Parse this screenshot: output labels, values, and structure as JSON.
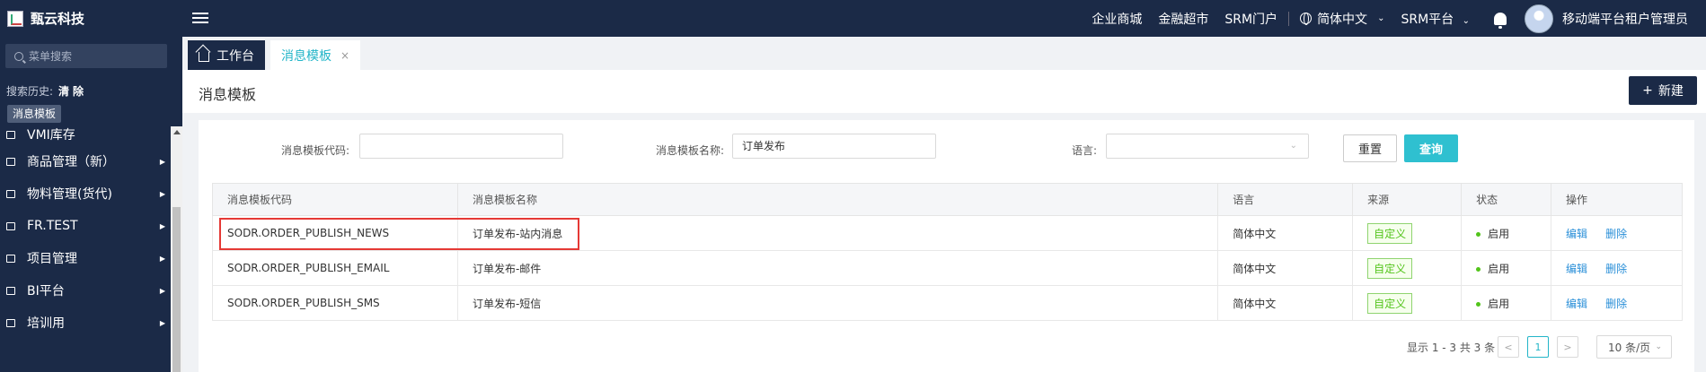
{
  "header": {
    "logo_text": "甄云科技",
    "nav_links": [
      "企业商城",
      "金融超市",
      "SRM门户"
    ],
    "language": "简体中文",
    "platform": "SRM平台",
    "user_name": "移动端平台租户管理员"
  },
  "sidebar": {
    "search_placeholder": "菜单搜索",
    "history_label": "搜索历史:",
    "clear_label": "清除",
    "history_tag": "消息模板",
    "items": [
      {
        "label": "VMI库存"
      },
      {
        "label": "商品管理（新）"
      },
      {
        "label": "物料管理(货代)"
      },
      {
        "label": "FR.TEST"
      },
      {
        "label": "项目管理"
      },
      {
        "label": "BI平台"
      },
      {
        "label": "培训用"
      }
    ]
  },
  "tabs": {
    "home": "工作台",
    "active": "消息模板",
    "close": "×"
  },
  "page": {
    "title": "消息模板",
    "new_button": "新建"
  },
  "filters": {
    "code_label": "消息模板代码:",
    "code_value": "",
    "name_label": "消息模板名称:",
    "name_value": "订单发布",
    "lang_label": "语言:",
    "lang_value": "",
    "reset": "重置",
    "query": "查询"
  },
  "table": {
    "headers": [
      "消息模板代码",
      "消息模板名称",
      "语言",
      "来源",
      "状态",
      "操作"
    ],
    "rows": [
      {
        "code": "SODR.ORDER_PUBLISH_NEWS",
        "name": "订单发布-站内消息",
        "lang": "简体中文",
        "source": "自定义",
        "status": "启用",
        "edit": "编辑",
        "delete": "删除"
      },
      {
        "code": "SODR.ORDER_PUBLISH_EMAIL",
        "name": "订单发布-邮件",
        "lang": "简体中文",
        "source": "自定义",
        "status": "启用",
        "edit": "编辑",
        "delete": "删除"
      },
      {
        "code": "SODR.ORDER_PUBLISH_SMS",
        "name": "订单发布-短信",
        "lang": "简体中文",
        "source": "自定义",
        "status": "启用",
        "edit": "编辑",
        "delete": "删除"
      }
    ]
  },
  "pagination": {
    "summary": "显示 1 - 3 共 3 条",
    "prev": "<",
    "current": "1",
    "next": ">",
    "page_size": "10 条/页"
  },
  "colors": {
    "nav_bg": "#1b2a47",
    "accent": "#2fc0d0",
    "link": "#2a8fd8",
    "highlight_border": "#e53935",
    "status_green": "#52c41a"
  }
}
